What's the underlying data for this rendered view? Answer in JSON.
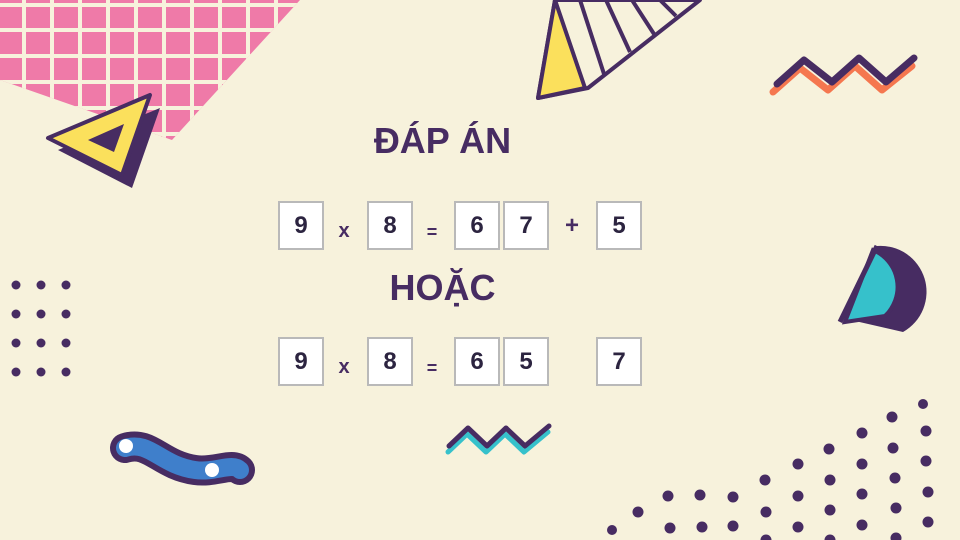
{
  "title": "ĐÁP ÁN",
  "or_label": "HOẶC",
  "answer_1": {
    "a": "9",
    "op1": "x",
    "b": "8",
    "eq": "=",
    "r1": "6",
    "r2": "7",
    "op2": "+",
    "rem": "5"
  },
  "answer_2": {
    "a": "9",
    "op1": "x",
    "b": "8",
    "eq": "=",
    "r1": "6",
    "r2": "5",
    "rem": "7"
  },
  "colors": {
    "background": "#f7f2dc",
    "purple": "#472c62",
    "pink": "#ef7aa8",
    "yellow": "#fbe05c",
    "teal": "#36c1cb",
    "blue": "#3f7fcb",
    "orange": "#f5774f"
  }
}
